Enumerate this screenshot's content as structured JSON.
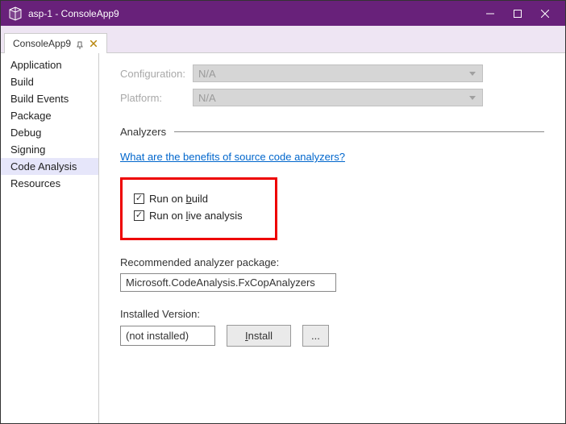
{
  "titlebar": {
    "title": "asp-1 - ConsoleApp9"
  },
  "tab": {
    "label": "ConsoleApp9"
  },
  "sidebar": {
    "items": [
      {
        "label": "Application"
      },
      {
        "label": "Build"
      },
      {
        "label": "Build Events"
      },
      {
        "label": "Package"
      },
      {
        "label": "Debug"
      },
      {
        "label": "Signing"
      },
      {
        "label": "Code Analysis"
      },
      {
        "label": "Resources"
      }
    ],
    "selected_index": 6
  },
  "config": {
    "configuration_label": "Configuration:",
    "configuration_value": "N/A",
    "platform_label": "Platform:",
    "platform_value": "N/A"
  },
  "section": {
    "title": "Analyzers"
  },
  "help_link": "What are the benefits of source code analyzers?",
  "checkboxes": {
    "run_on_build": {
      "prefix": "Run on ",
      "accel": "b",
      "suffix": "uild",
      "checked": true
    },
    "run_on_live": {
      "prefix": "Run on ",
      "accel": "l",
      "suffix": "ive analysis",
      "checked": true
    }
  },
  "recommended": {
    "label": "Recommended analyzer package:",
    "value": "Microsoft.CodeAnalysis.FxCopAnalyzers"
  },
  "installed": {
    "label": "Installed Version:",
    "value": "(not installed)",
    "install_btn_accel": "I",
    "install_btn_suffix": "nstall",
    "browse_btn": "..."
  }
}
